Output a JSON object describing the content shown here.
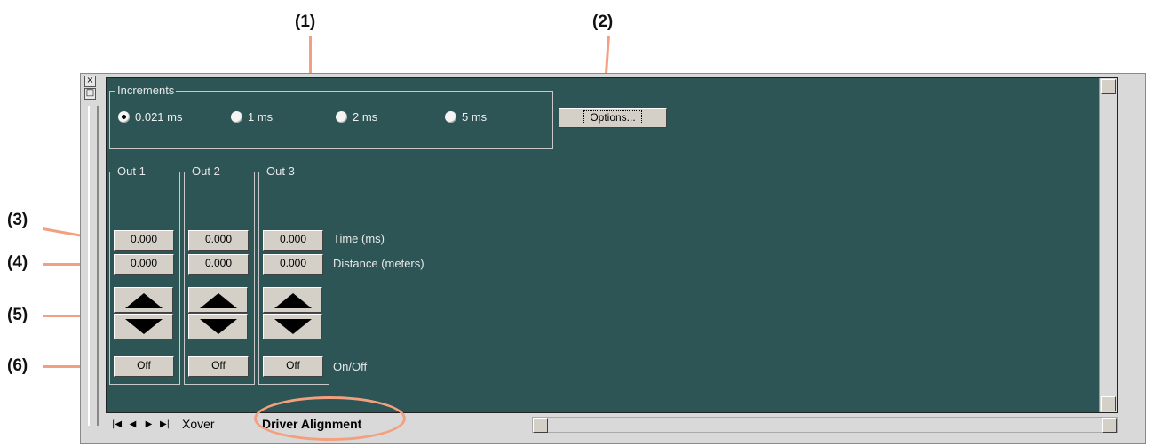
{
  "callouts": [
    "(1)",
    "(2)",
    "(3)",
    "(4)",
    "(5)",
    "(6)"
  ],
  "window": {
    "close_glyph": "×",
    "restore_glyph": "□"
  },
  "increments": {
    "title": "Increments",
    "options": [
      {
        "label": "0.021 ms",
        "selected": true
      },
      {
        "label": "1 ms",
        "selected": false
      },
      {
        "label": "2 ms",
        "selected": false
      },
      {
        "label": "5 ms",
        "selected": false
      }
    ]
  },
  "options_button": "Options...",
  "outputs": [
    {
      "title": "Out 1",
      "time": "0.000",
      "distance": "0.000",
      "onoff": "Off"
    },
    {
      "title": "Out 2",
      "time": "0.000",
      "distance": "0.000",
      "onoff": "Off"
    },
    {
      "title": "Out 3",
      "time": "0.000",
      "distance": "0.000",
      "onoff": "Off"
    }
  ],
  "row_labels": {
    "time": "Time (ms)",
    "distance": "Distance (meters)",
    "onoff": "On/Off"
  },
  "tabs": {
    "nav": [
      "|◀",
      "◀",
      "▶",
      "▶|"
    ],
    "items": [
      "Xover",
      "Driver Alignment"
    ],
    "active": "Driver Alignment"
  },
  "icons": {
    "up": "triangle-up-icon",
    "down": "triangle-down-icon"
  },
  "colors": {
    "panel": "#2e5555",
    "callout_line": "#f2a07f"
  }
}
